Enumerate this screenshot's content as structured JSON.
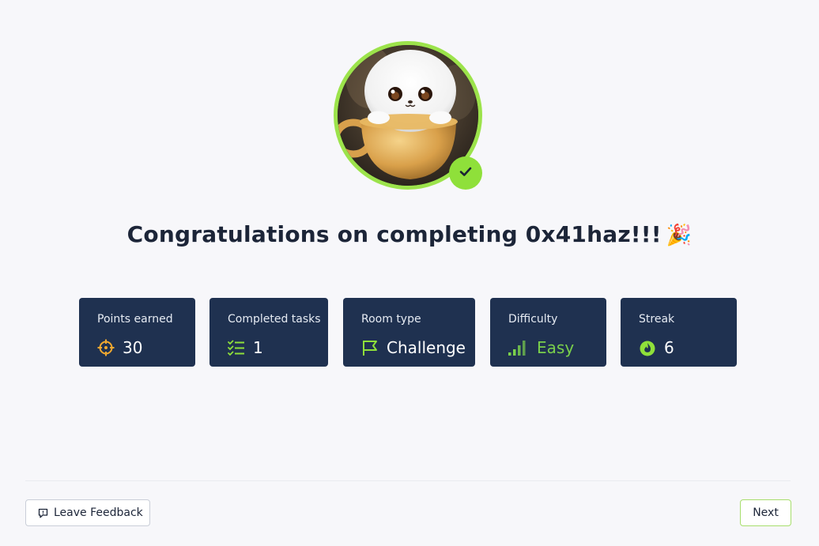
{
  "room": {
    "title": "Congratulations on completing 0x41haz!!!",
    "celebration_emoji": "🎉"
  },
  "avatar": {
    "icon": "cat-in-cup-avatar",
    "completed_icon": "check-icon",
    "accent_color": "#9ce34b"
  },
  "stats": [
    {
      "label": "Points earned",
      "value": "30",
      "icon": "crosshair-icon"
    },
    {
      "label": "Completed tasks",
      "value": "1",
      "icon": "checklist-icon"
    },
    {
      "label": "Room type",
      "value": "Challenge",
      "icon": "flag-icon"
    },
    {
      "label": "Difficulty",
      "value": "Easy",
      "icon": "signal-bars-icon"
    },
    {
      "label": "Streak",
      "value": "6",
      "icon": "flame-icon"
    }
  ],
  "footer": {
    "feedback_label": "Leave Feedback",
    "next_label": "Next"
  },
  "colors": {
    "card_bg": "#1f3150",
    "accent_green": "#8fe03a",
    "points_orange": "#f0a830",
    "difficulty_green": "#7ad04b"
  }
}
